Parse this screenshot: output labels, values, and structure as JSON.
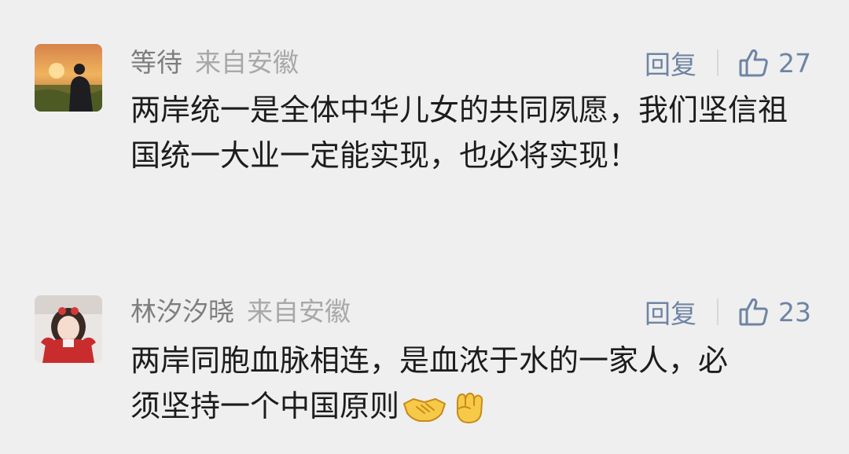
{
  "comments": [
    {
      "nickname": "等待",
      "location": "来自安徽",
      "reply_label": "回复",
      "likes": "27",
      "avatar_icon": "sunset-silhouette-avatar",
      "content": "两岸统一是全体中华儿女的共同夙愿，我们坚信祖国统一大业一定能实现，也必将实现！"
    },
    {
      "nickname": "林汐汐晓",
      "location": "来自安徽",
      "reply_label": "回复",
      "likes": "23",
      "avatar_icon": "girl-red-sweater-avatar",
      "content": "两岸同胞血脉相连，是血浓于水的一家人，必须坚持一个中国原则",
      "emojis": [
        "handshake-emoji",
        "raised-fist-emoji"
      ]
    }
  ],
  "colors": {
    "background": "#efefef",
    "nickname": "#7e7e7e",
    "location": "#a8a8a8",
    "action_blue": "#6f84a3",
    "content_text": "#1c1c1c"
  }
}
